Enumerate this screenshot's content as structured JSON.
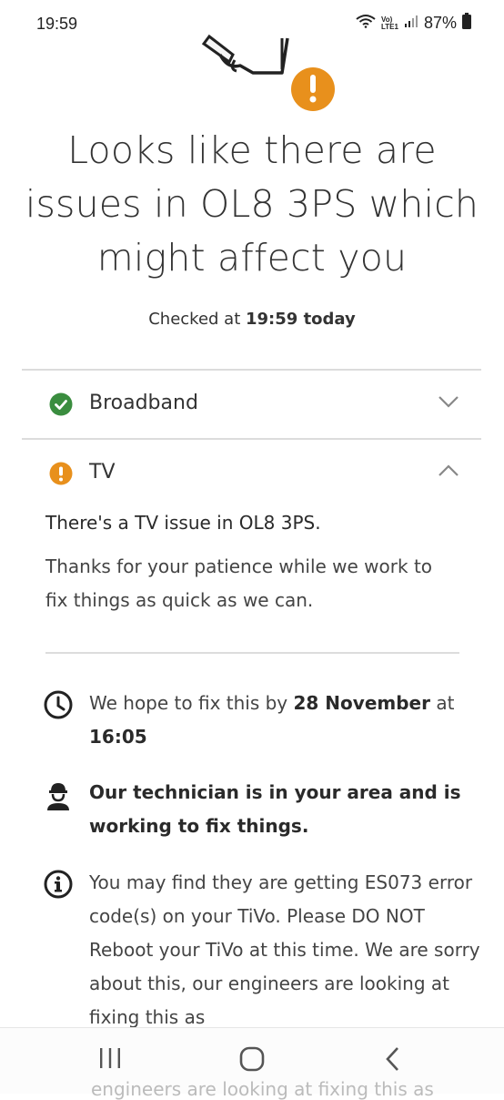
{
  "status_bar": {
    "time": "19:59",
    "battery": "87%",
    "volte_top": "Vo)",
    "volte_bottom": "LTE1"
  },
  "title": "Looks like there are issues in OL8 3PS which might affect you",
  "checked": {
    "prefix": "Checked at ",
    "time": "19:59 today"
  },
  "services": [
    {
      "label": "Broadband",
      "status": "ok",
      "expanded": false
    },
    {
      "label": "TV",
      "status": "issue",
      "expanded": true
    }
  ],
  "tv_issue": {
    "heading": "There's a TV issue in OL8 3PS.",
    "body": "Thanks for your patience while we work to fix things as quick as we can."
  },
  "info": {
    "fix_prefix": "We hope to fix this by ",
    "fix_date": "28 November",
    "fix_mid": " at ",
    "fix_time": "16:05",
    "technician": "Our technician is in your area and is working to fix things.",
    "tivo_note": "You may find they are getting ES073 error code(s) on your TiVo. Please DO NOT Reboot your TiVo at this time. We are sorry about this, our engineers are looking at fixing this as"
  },
  "behind_nav_text": "engineers are looking at fixing this as",
  "colors": {
    "ok": "#3a8d3f",
    "issue": "#e8901c",
    "divider": "#dcdcdc"
  }
}
